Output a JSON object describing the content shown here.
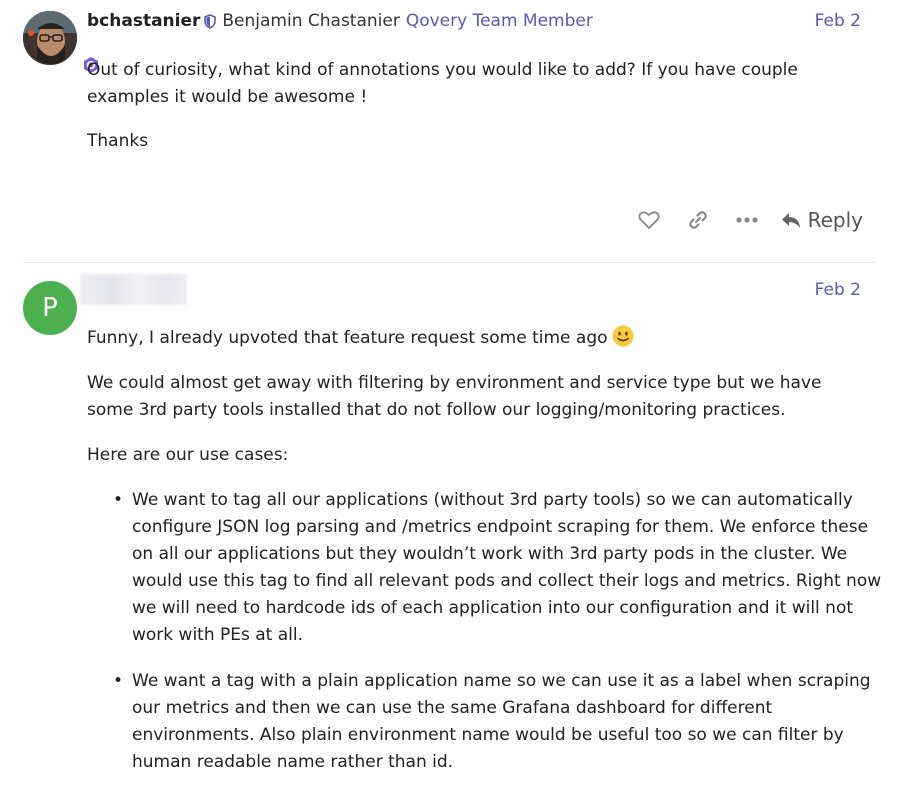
{
  "post1": {
    "username": "bchastanier",
    "full_name": "Benjamin Chastanier",
    "user_title": "Qovery Team Member",
    "date": "Feb 2",
    "paragraphs": [
      "Out of curiosity, what kind of annotations you would like to add? If you have couple examples it would be awesome !",
      "Thanks"
    ],
    "actions": {
      "like_icon": "heart-icon",
      "link_icon": "link-icon",
      "more_icon": "ellipsis-icon",
      "reply_label": "Reply"
    }
  },
  "post2": {
    "avatar_letter": "P",
    "avatar_color": "#4caf50",
    "date": "Feb 2",
    "intro": "Funny, I already upvoted that feature request some time ago",
    "emoji": "slightly-smiling-face",
    "paragraph2": "We could almost get away with filtering by environment and service type but we have some 3rd party tools installed that do not follow our logging/monitoring practices.",
    "paragraph3": "Here are our use cases:",
    "use_cases": [
      "We want to tag all our applications (without 3rd party tools) so we can automatically configure JSON log parsing and /metrics endpoint scraping for them. We enforce these on all our applications but they wouldn’t work with 3rd party pods in the cluster. We would use this tag to find all relevant pods and collect their logs and metrics. Right now we will need to hardcode ids of each application into our configuration and it will not work with PEs at all.",
      "We want a tag with a plain application name so we can use it as a label when scraping our metrics and then we can use the same Grafana dashboard for different environments. Also plain environment name would be useful too so we can filter by human readable name rather than id."
    ]
  },
  "colors": {
    "accent": "#5b58b3",
    "text": "#222222",
    "muted": "#6b6b6b",
    "divider": "#e5e5e5"
  }
}
